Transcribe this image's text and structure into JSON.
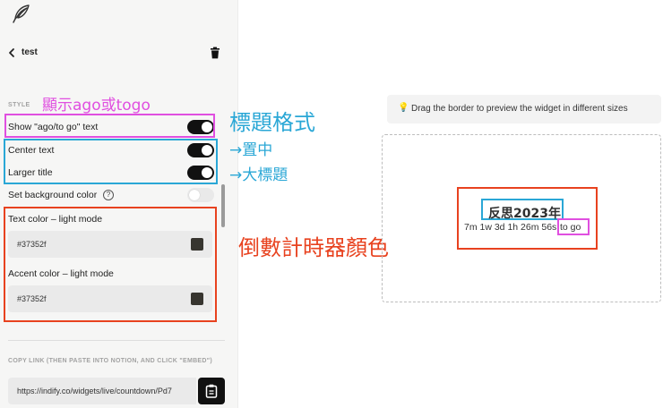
{
  "header": {
    "title": "test"
  },
  "style_section": {
    "label": "STYLE",
    "toggles": [
      {
        "label": "Show \"ago/to go\" text",
        "on": true
      },
      {
        "label": "Center text",
        "on": true
      },
      {
        "label": "Larger title",
        "on": true
      },
      {
        "label": "Set background color",
        "on": false,
        "help": "?"
      }
    ],
    "colors": [
      {
        "label": "Text color – light mode",
        "value": "#37352f"
      },
      {
        "label": "Accent color – light mode",
        "value": "#37352f"
      }
    ]
  },
  "copy_section": {
    "label": "COPY LINK (THEN PASTE INTO NOTION, AND CLICK \"EMBED\")",
    "url": "https://indify.co/widgets/live/countdown/Pd7"
  },
  "preview": {
    "hint": "Drag the border to preview the widget in different sizes",
    "widget_title": "反思2023年",
    "countdown": "7m 1w 3d 1h 26m 56s",
    "suffix": "to go"
  },
  "annotations": {
    "ago_togo": "顯示ago或togo",
    "title_format": "標題格式",
    "center": "→置中",
    "larger_title": "→大標題",
    "timer_color": "倒數計時器顏色"
  },
  "colors": {
    "annotation_pink": "#e04fe0",
    "annotation_blue": "#2aa7d6",
    "annotation_red": "#e8421f",
    "toggle_on": "#111111",
    "panel_bg": "#f6f6f5"
  }
}
